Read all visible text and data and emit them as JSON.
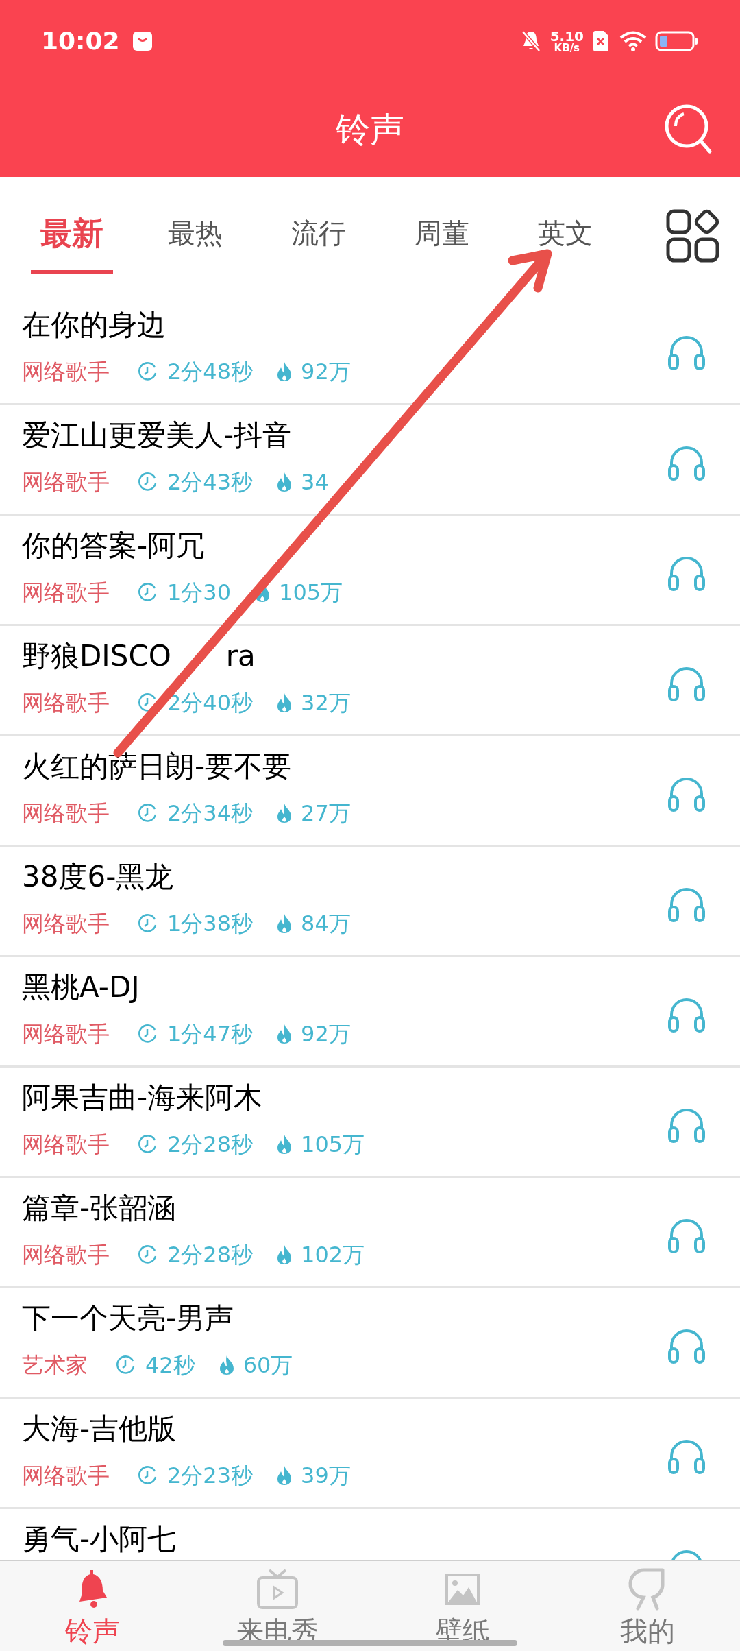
{
  "status_bar": {
    "time": "10:02",
    "speed_value": "5.10",
    "speed_unit": "KB/s"
  },
  "header": {
    "title": "铃声"
  },
  "tabs": [
    {
      "label": "最新",
      "selected": true
    },
    {
      "label": "最热",
      "selected": false
    },
    {
      "label": "流行",
      "selected": false
    },
    {
      "label": "周董",
      "selected": false
    },
    {
      "label": "英文",
      "selected": false
    }
  ],
  "songs": [
    {
      "title": "在你的身边",
      "artist": "网络歌手",
      "duration": "2分48秒",
      "plays": "92万"
    },
    {
      "title": "爱江山更爱美人-抖音",
      "artist": "网络歌手",
      "duration": "2分43秒",
      "plays": "34"
    },
    {
      "title": "你的答案-阿冗",
      "artist": "网络歌手",
      "duration": "1分30",
      "plays": "105万"
    },
    {
      "title": "野狼DISCO",
      "title_after_arrow": "ra",
      "artist": "网络歌手",
      "duration": "2分40秒",
      "plays": "32万"
    },
    {
      "title": "火红的萨日朗-要不要",
      "artist": "网络歌手",
      "duration": "2分34秒",
      "plays": "27万"
    },
    {
      "title": "38度6-黑龙",
      "artist": "网络歌手",
      "duration": "1分38秒",
      "plays": "84万"
    },
    {
      "title": "黑桃A-DJ",
      "artist": "网络歌手",
      "duration": "1分47秒",
      "plays": "92万"
    },
    {
      "title": "阿果吉曲-海来阿木",
      "artist": "网络歌手",
      "duration": "2分28秒",
      "plays": "105万"
    },
    {
      "title": "篇章-张韶涵",
      "artist": "网络歌手",
      "duration": "2分28秒",
      "plays": "102万"
    },
    {
      "title": "下一个天亮-男声",
      "artist": "艺术家",
      "duration": "42秒",
      "plays": "60万"
    },
    {
      "title": "大海-吉他版",
      "artist": "网络歌手",
      "duration": "2分23秒",
      "plays": "39万"
    },
    {
      "title": "勇气-小阿七"
    }
  ],
  "bottom_nav": [
    {
      "label": "铃声",
      "kind": "bell",
      "selected": true
    },
    {
      "label": "来电秀",
      "kind": "tv",
      "selected": false
    },
    {
      "label": "壁纸",
      "kind": "image",
      "selected": false
    },
    {
      "label": "我的",
      "kind": "person",
      "selected": false
    }
  ]
}
